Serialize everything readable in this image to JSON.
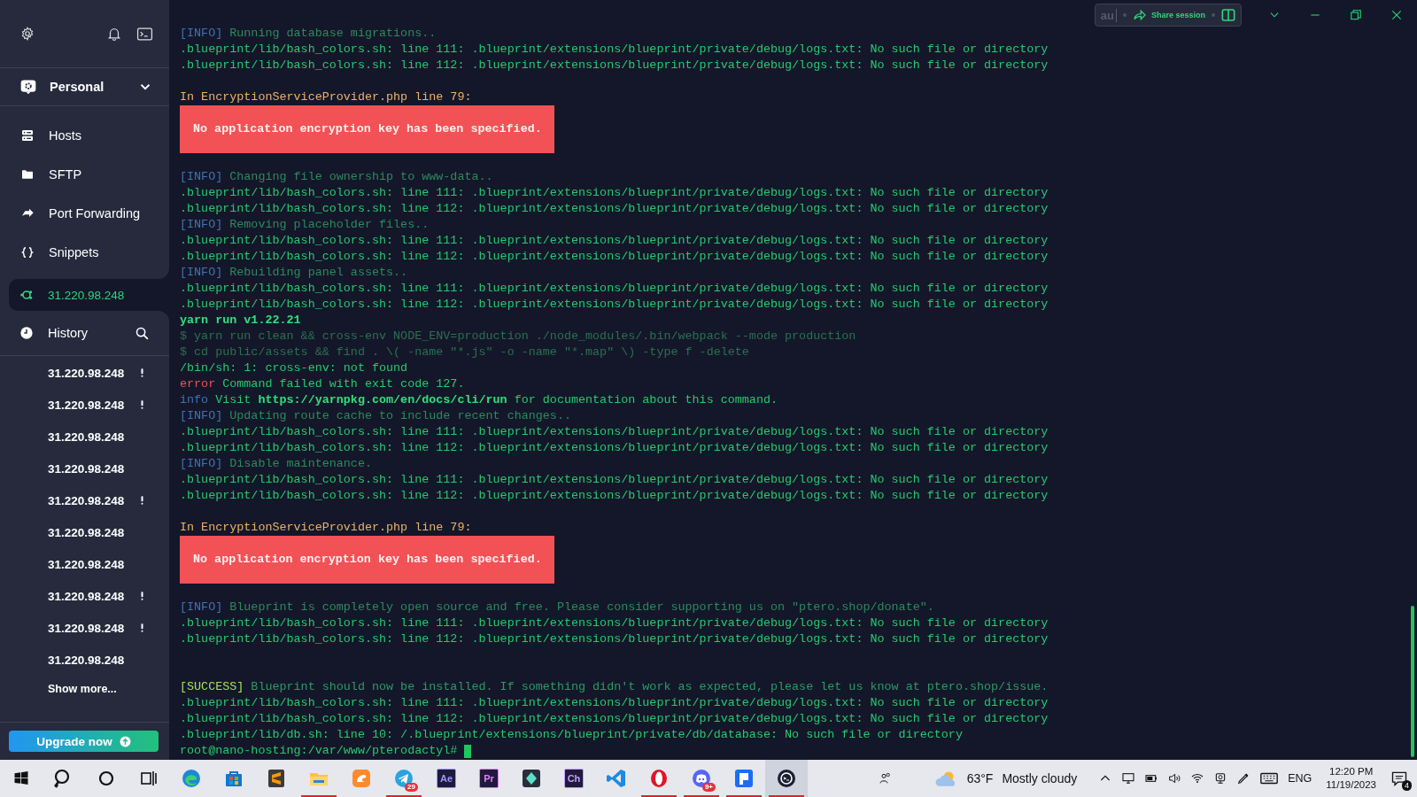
{
  "sidebar": {
    "workspace": {
      "label": "Personal"
    },
    "nav": [
      {
        "kind": "hosts",
        "label": "Hosts"
      },
      {
        "kind": "sftp",
        "label": "SFTP"
      },
      {
        "kind": "port_forwarding",
        "label": "Port Forwarding"
      },
      {
        "kind": "snippets",
        "label": "Snippets"
      }
    ],
    "active_session": {
      "label": "31.220.98.248"
    },
    "history": {
      "title": "History",
      "items": [
        {
          "label": "31.220.98.248",
          "warning": true
        },
        {
          "label": "31.220.98.248",
          "warning": true
        },
        {
          "label": "31.220.98.248",
          "warning": false
        },
        {
          "label": "31.220.98.248",
          "warning": false
        },
        {
          "label": "31.220.98.248",
          "warning": true
        },
        {
          "label": "31.220.98.248",
          "warning": false
        },
        {
          "label": "31.220.98.248",
          "warning": false
        },
        {
          "label": "31.220.98.248",
          "warning": true
        },
        {
          "label": "31.220.98.248",
          "warning": true
        },
        {
          "label": "31.220.98.248",
          "warning": false
        }
      ],
      "show_more": "Show more..."
    },
    "upgrade": "Upgrade now"
  },
  "share_session": {
    "user_text": "au",
    "label": "Share session"
  },
  "terminal": {
    "lines": [
      {
        "kind": "text",
        "segments": [
          {
            "kind": "tag",
            "text": "[INFO]"
          },
          {
            "kind": "info",
            "text": " Running database migrations.."
          }
        ]
      },
      {
        "kind": "text",
        "segments": [
          {
            "kind": "normal",
            "text": ".blueprint/lib/bash_colors.sh: line 111: .blueprint/extensions/blueprint/private/debug/logs.txt: No such file or directory"
          }
        ]
      },
      {
        "kind": "text",
        "segments": [
          {
            "kind": "normal",
            "text": ".blueprint/lib/bash_colors.sh: line 112: .blueprint/extensions/blueprint/private/debug/logs.txt: No such file or directory"
          }
        ]
      },
      {
        "kind": "blank"
      },
      {
        "kind": "heading",
        "text": "In EncryptionServiceProvider.php line 79:"
      },
      {
        "kind": "error_box",
        "text": "No application encryption key has been specified."
      },
      {
        "kind": "blank"
      },
      {
        "kind": "text",
        "segments": [
          {
            "kind": "tag",
            "text": "[INFO]"
          },
          {
            "kind": "info",
            "text": " Changing file ownership to www-data.."
          }
        ]
      },
      {
        "kind": "text",
        "segments": [
          {
            "kind": "normal",
            "text": ".blueprint/lib/bash_colors.sh: line 111: .blueprint/extensions/blueprint/private/debug/logs.txt: No such file or directory"
          }
        ]
      },
      {
        "kind": "text",
        "segments": [
          {
            "kind": "normal",
            "text": ".blueprint/lib/bash_colors.sh: line 112: .blueprint/extensions/blueprint/private/debug/logs.txt: No such file or directory"
          }
        ]
      },
      {
        "kind": "text",
        "segments": [
          {
            "kind": "tag",
            "text": "[INFO]"
          },
          {
            "kind": "info",
            "text": " Removing placeholder files.."
          }
        ]
      },
      {
        "kind": "text",
        "segments": [
          {
            "kind": "normal",
            "text": ".blueprint/lib/bash_colors.sh: line 111: .blueprint/extensions/blueprint/private/debug/logs.txt: No such file or directory"
          }
        ]
      },
      {
        "kind": "text",
        "segments": [
          {
            "kind": "normal",
            "text": ".blueprint/lib/bash_colors.sh: line 112: .blueprint/extensions/blueprint/private/debug/logs.txt: No such file or directory"
          }
        ]
      },
      {
        "kind": "text",
        "segments": [
          {
            "kind": "tag",
            "text": "[INFO]"
          },
          {
            "kind": "info",
            "text": " Rebuilding panel assets.."
          }
        ]
      },
      {
        "kind": "text",
        "segments": [
          {
            "kind": "normal",
            "text": ".blueprint/lib/bash_colors.sh: line 111: .blueprint/extensions/blueprint/private/debug/logs.txt: No such file or directory"
          }
        ]
      },
      {
        "kind": "text",
        "segments": [
          {
            "kind": "normal",
            "text": ".blueprint/lib/bash_colors.sh: line 112: .blueprint/extensions/blueprint/private/debug/logs.txt: No such file or directory"
          }
        ]
      },
      {
        "kind": "text",
        "segments": [
          {
            "kind": "bold",
            "text": "yarn run v1.22.21"
          }
        ]
      },
      {
        "kind": "text",
        "segments": [
          {
            "kind": "dim",
            "text": "$ yarn run clean && cross-env NODE_ENV=production ./node_modules/.bin/webpack --mode production"
          }
        ]
      },
      {
        "kind": "text",
        "segments": [
          {
            "kind": "dim",
            "text": "$ cd public/assets && find . \\( -name \"*.js\" -o -name \"*.map\" \\) -type f -delete"
          }
        ]
      },
      {
        "kind": "text",
        "segments": [
          {
            "kind": "normal",
            "text": "/bin/sh: 1: cross-env: not found"
          }
        ]
      },
      {
        "kind": "text",
        "segments": [
          {
            "kind": "error",
            "text": "error"
          },
          {
            "kind": "normal",
            "text": " Command failed with exit code 127."
          }
        ]
      },
      {
        "kind": "text",
        "segments": [
          {
            "kind": "tag",
            "text": "info"
          },
          {
            "kind": "normal",
            "text": " Visit "
          },
          {
            "kind": "bold",
            "text": "https://yarnpkg.com/en/docs/cli/run"
          },
          {
            "kind": "normal",
            "text": " for documentation about this command."
          }
        ]
      },
      {
        "kind": "text",
        "segments": [
          {
            "kind": "tag",
            "text": "[INFO]"
          },
          {
            "kind": "info",
            "text": " Updating route cache to include recent changes.."
          }
        ]
      },
      {
        "kind": "text",
        "segments": [
          {
            "kind": "normal",
            "text": ".blueprint/lib/bash_colors.sh: line 111: .blueprint/extensions/blueprint/private/debug/logs.txt: No such file or directory"
          }
        ]
      },
      {
        "kind": "text",
        "segments": [
          {
            "kind": "normal",
            "text": ".blueprint/lib/bash_colors.sh: line 112: .blueprint/extensions/blueprint/private/debug/logs.txt: No such file or directory"
          }
        ]
      },
      {
        "kind": "text",
        "segments": [
          {
            "kind": "tag",
            "text": "[INFO]"
          },
          {
            "kind": "info",
            "text": " Disable maintenance."
          }
        ]
      },
      {
        "kind": "text",
        "segments": [
          {
            "kind": "normal",
            "text": ".blueprint/lib/bash_colors.sh: line 111: .blueprint/extensions/blueprint/private/debug/logs.txt: No such file or directory"
          }
        ]
      },
      {
        "kind": "text",
        "segments": [
          {
            "kind": "normal",
            "text": ".blueprint/lib/bash_colors.sh: line 112: .blueprint/extensions/blueprint/private/debug/logs.txt: No such file or directory"
          }
        ]
      },
      {
        "kind": "blank"
      },
      {
        "kind": "heading",
        "text": "In EncryptionServiceProvider.php line 79:"
      },
      {
        "kind": "error_box",
        "text": "No application encryption key has been specified."
      },
      {
        "kind": "blank"
      },
      {
        "kind": "text",
        "segments": [
          {
            "kind": "tag",
            "text": "[INFO]"
          },
          {
            "kind": "info",
            "text": " Blueprint is completely open source and free. Please consider supporting us on \"ptero.shop/donate\"."
          }
        ]
      },
      {
        "kind": "text",
        "segments": [
          {
            "kind": "normal",
            "text": ".blueprint/lib/bash_colors.sh: line 111: .blueprint/extensions/blueprint/private/debug/logs.txt: No such file or directory"
          }
        ]
      },
      {
        "kind": "text",
        "segments": [
          {
            "kind": "normal",
            "text": ".blueprint/lib/bash_colors.sh: line 112: .blueprint/extensions/blueprint/private/debug/logs.txt: No such file or directory"
          }
        ]
      },
      {
        "kind": "blank"
      },
      {
        "kind": "blank"
      },
      {
        "kind": "text",
        "segments": [
          {
            "kind": "success_tag",
            "text": "[SUCCESS]"
          },
          {
            "kind": "success",
            "text": " Blueprint should now be installed. If something didn't work as expected, please let us know at ptero.shop/issue."
          }
        ]
      },
      {
        "kind": "text",
        "segments": [
          {
            "kind": "normal",
            "text": ".blueprint/lib/bash_colors.sh: line 111: .blueprint/extensions/blueprint/private/debug/logs.txt: No such file or directory"
          }
        ]
      },
      {
        "kind": "text",
        "segments": [
          {
            "kind": "normal",
            "text": ".blueprint/lib/bash_colors.sh: line 112: .blueprint/extensions/blueprint/private/debug/logs.txt: No such file or directory"
          }
        ]
      },
      {
        "kind": "text",
        "segments": [
          {
            "kind": "normal",
            "text": ".blueprint/lib/db.sh: line 10: /.blueprint/extensions/blueprint/private/db/database: No such file or directory"
          }
        ]
      },
      {
        "kind": "prompt",
        "text": "root@nano-hosting:/var/www/pterodactyl# "
      }
    ]
  },
  "taskbar": {
    "apps": [
      {
        "kind": "start",
        "running": false,
        "active": false
      },
      {
        "kind": "search",
        "running": false,
        "active": false
      },
      {
        "kind": "cortana",
        "running": false,
        "active": false
      },
      {
        "kind": "task_view",
        "running": false,
        "active": false
      },
      {
        "kind": "edge",
        "running": false,
        "active": false
      },
      {
        "kind": "store",
        "running": false,
        "active": false
      },
      {
        "kind": "sublime",
        "running": false,
        "active": false
      },
      {
        "kind": "explorer",
        "running": true,
        "active": false
      },
      {
        "kind": "uc",
        "running": false,
        "active": false
      },
      {
        "kind": "telegram",
        "running": true,
        "active": false,
        "badge": "29"
      },
      {
        "kind": "tile",
        "label": "Ae",
        "color": "#9999ff",
        "running": false,
        "active": false
      },
      {
        "kind": "tile",
        "label": "Pr",
        "color": "#e77cff",
        "running": false,
        "active": false
      },
      {
        "kind": "filmora",
        "running": false,
        "active": false
      },
      {
        "kind": "tile",
        "label": "Ch",
        "color": "#c49cff",
        "running": false,
        "active": false
      },
      {
        "kind": "vscode",
        "running": false,
        "active": false
      },
      {
        "kind": "opera",
        "running": true,
        "active": false
      },
      {
        "kind": "discord",
        "running": true,
        "active": false,
        "badge": "9+"
      },
      {
        "kind": "blue_app",
        "running": true,
        "active": false
      },
      {
        "kind": "termius",
        "running": true,
        "active": true
      }
    ],
    "weather": {
      "temperature": "63°F",
      "condition": "Mostly cloudy"
    },
    "language": "ENG",
    "time": "12:20 PM",
    "date": "11/19/2023",
    "notifications": "4"
  }
}
